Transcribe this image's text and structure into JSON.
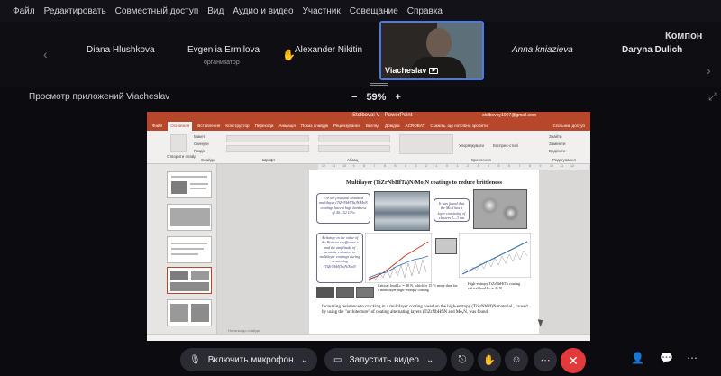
{
  "menu": [
    "Файл",
    "Редактировать",
    "Совместный доступ",
    "Вид",
    "Аудио и видео",
    "Участник",
    "Совещание",
    "Справка"
  ],
  "participants": [
    {
      "name": "Diana Hlushkova",
      "role": ""
    },
    {
      "name": "Evgeniia Ermilova",
      "role": "организатор"
    },
    {
      "name": "Alexander Nikitin",
      "role": ""
    },
    {
      "name": "Anna kniazieva",
      "role": ""
    },
    {
      "name": "Daryna Dulich",
      "role": ""
    }
  ],
  "active_speaker": {
    "name": "Viacheslav"
  },
  "layout_button": "Компон",
  "viewer": {
    "title": "Просмотр приложений Viacheslav",
    "zoom_minus": "−",
    "zoom": "59%",
    "zoom_plus": "+"
  },
  "powerpoint": {
    "window_title": "Stolbovoi V - PowerPoint",
    "user": "stolbovoy1907@gmail.com",
    "tabs": [
      "Файл",
      "Основная",
      "Вставлення",
      "Конструктор",
      "Переходи",
      "Анімація",
      "Показ слайдів",
      "Рецензування",
      "Вигляд",
      "Довідка",
      "ACROBAT",
      "Скажіть, що потрібно зробити"
    ],
    "share_label": "Спільний доступ",
    "ribbon_labels": {
      "new_slide": "Створити слайд",
      "layout": "Макет",
      "reset": "Скинути",
      "section": "Розділ",
      "slides": "Слайди",
      "font": "Шрифт",
      "paragraph": "Абзац",
      "arrange": "Упорядкувати",
      "quick_styles": "Експрес-стилі",
      "drawing": "Креслення",
      "find": "Знайти",
      "replace": "Замінити",
      "select": "Виділити",
      "editing": "Редагування"
    },
    "ruler": [
      "12",
      "11",
      "10",
      "9",
      "8",
      "7",
      "6",
      "5",
      "4",
      "3",
      "2",
      "1",
      "0",
      "1",
      "2",
      "3",
      "4",
      "5",
      "6",
      "7",
      "8",
      "9",
      "10",
      "11",
      "12"
    ],
    "thumb_numbers": [
      "",
      "",
      "",
      "",
      "",
      ""
    ],
    "notes": "Нотатки до слайда"
  },
  "slide": {
    "title": "Multilayer (TiZrNbHfTa)N/MoₓN coatings to reduce brittleness",
    "callouts": [
      "For the first time obtained multilayer (TiZrNbHfTa)N/MoN coatings have a high hardness of 40—52 GPa",
      "It was found that the MoN has a layer consisting of clusters 2—3 nm",
      "A change in the value of the Poisson coefficient ν and the amplitude of acoustic emission in multilayer coatings during scratching (TiZrNbHfTa)N/MoN"
    ],
    "captions": [
      "Critical load Lc = 48 N, which is 15 % more than for a monolayer high-entropy coating",
      "High-entropy TiZrNbHfTa coating critical load Lc = 41 N"
    ],
    "conclusion": "Increasing resistance to cracking in a multilayer coating based on the high-entropy (TiZrNbHf)N material , caused by using the \"architecture\" of coating alternating layers (TiZrNbHf)N and MoₓN, was found"
  },
  "controls": {
    "mic": "Включить микрофон",
    "video": "Запустить видео"
  },
  "colors": {
    "ppt_accent": "#b7472a",
    "active_border": "#4a7ae8",
    "hangup": "#e23a3a",
    "hand": "#e9a23b"
  }
}
